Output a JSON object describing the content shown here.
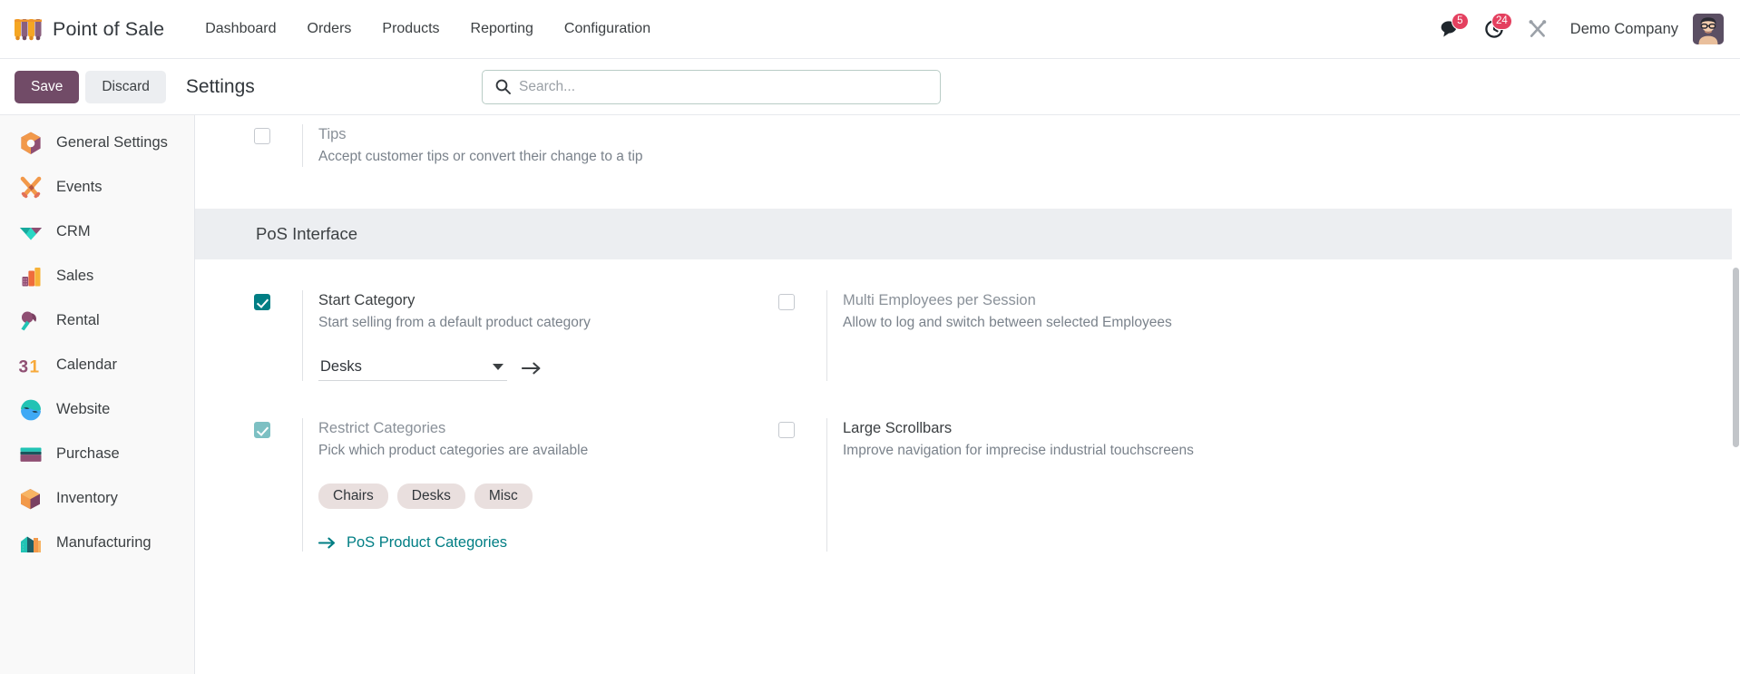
{
  "navbar": {
    "brand": "Point of Sale",
    "logo_icon": "pos-awning-icon",
    "links": [
      {
        "label": "Dashboard"
      },
      {
        "label": "Orders"
      },
      {
        "label": "Products"
      },
      {
        "label": "Reporting"
      },
      {
        "label": "Configuration"
      }
    ],
    "messages": {
      "icon": "chat-bubble-icon",
      "count": "5"
    },
    "activities": {
      "icon": "clock-icon",
      "count": "24"
    },
    "debug": {
      "icon": "wrench-tools-icon"
    },
    "company": "Demo Company",
    "avatar_icon": "user-avatar"
  },
  "control_panel": {
    "save_label": "Save",
    "discard_label": "Discard",
    "title": "Settings",
    "search": {
      "icon": "search-icon",
      "placeholder": "Search...",
      "value": ""
    }
  },
  "sidebar": {
    "items": [
      {
        "label": "General Settings",
        "icon": "settings-gear-icon"
      },
      {
        "label": "Events",
        "icon": "events-icon"
      },
      {
        "label": "CRM",
        "icon": "crm-icon"
      },
      {
        "label": "Sales",
        "icon": "sales-icon"
      },
      {
        "label": "Rental",
        "icon": "rental-key-icon"
      },
      {
        "label": "Calendar",
        "icon": "calendar-31-icon"
      },
      {
        "label": "Website",
        "icon": "website-icon"
      },
      {
        "label": "Purchase",
        "icon": "purchase-icon"
      },
      {
        "label": "Inventory",
        "icon": "inventory-box-icon"
      },
      {
        "label": "Manufacturing",
        "icon": "manufacturing-icon"
      }
    ]
  },
  "settings": {
    "tips": {
      "label": "Tips",
      "description": "Accept customer tips or convert their change to a tip",
      "checked": false
    },
    "section": {
      "title": "PoS Interface"
    },
    "start_category": {
      "label": "Start Category",
      "description": "Start selling from a default product category",
      "checked": true,
      "dropdown_value": "Desks",
      "dropdown_caret_icon": "chevron-down-icon",
      "internal_link_icon": "arrow-right-icon"
    },
    "multi_employees": {
      "label": "Multi Employees per Session",
      "description": "Allow to log and switch between selected Employees",
      "checked": false
    },
    "restrict_categories": {
      "label": "Restrict Categories",
      "description": "Pick which product categories are available",
      "checked": true,
      "tags": [
        "Chairs",
        "Desks",
        "Misc"
      ],
      "link_label": "PoS Product Categories",
      "link_icon": "arrow-right-icon"
    },
    "large_scrollbars": {
      "label": "Large Scrollbars",
      "description": "Improve navigation for imprecise industrial touchscreens",
      "checked": false
    }
  },
  "colors": {
    "brand_purple": "#714b67",
    "accent_teal": "#017e84",
    "badge_red": "#e4405f",
    "tag_bg": "#e9dfde",
    "section_bg": "#eceef1"
  }
}
